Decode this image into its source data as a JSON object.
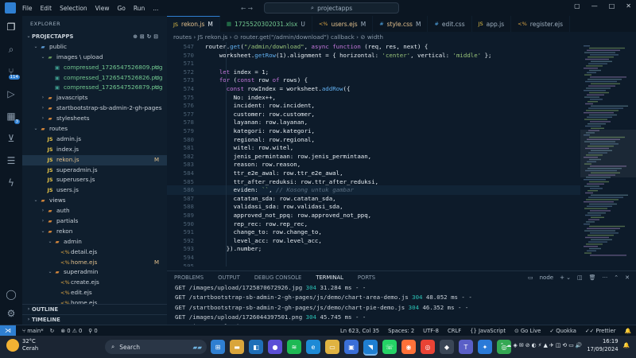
{
  "menu": {
    "items": [
      "File",
      "Edit",
      "Selection",
      "View",
      "Go",
      "Run",
      "..."
    ]
  },
  "command_center": {
    "text": "projectapps"
  },
  "activity_bar": {
    "badge_scm": "114",
    "badge_ext": "3"
  },
  "explorer": {
    "header": "EXPLORER",
    "project": "PROJECTAPPS",
    "rows": [
      {
        "label": "public",
        "indent": 1,
        "chev": "⌄",
        "icon": "dir-blue",
        "status": ""
      },
      {
        "label": "images \\ upload",
        "indent": 2,
        "chev": "⌄",
        "icon": "dir-green",
        "status": ""
      },
      {
        "label": "compressed_1726547526809.png",
        "indent": 3,
        "chev": "",
        "icon": "img",
        "status": "U"
      },
      {
        "label": "compressed_1726547526826.png",
        "indent": 3,
        "chev": "",
        "icon": "img",
        "status": "U"
      },
      {
        "label": "compressed_1726547526879.png",
        "indent": 3,
        "chev": "",
        "icon": "img",
        "status": "U"
      },
      {
        "label": "javascripts",
        "indent": 2,
        "chev": "›",
        "icon": "dir",
        "status": ""
      },
      {
        "label": "startbootstrap-sb-admin-2-gh-pages",
        "indent": 2,
        "chev": "›",
        "icon": "dir",
        "status": ""
      },
      {
        "label": "stylesheets",
        "indent": 2,
        "chev": "›",
        "icon": "dir",
        "status": ""
      },
      {
        "label": "routes",
        "indent": 1,
        "chev": "⌄",
        "icon": "dir",
        "status": ""
      },
      {
        "label": "admin.js",
        "indent": 2,
        "chev": "",
        "icon": "js",
        "status": ""
      },
      {
        "label": "index.js",
        "indent": 2,
        "chev": "",
        "icon": "js",
        "status": ""
      },
      {
        "label": "rekon.js",
        "indent": 2,
        "chev": "",
        "icon": "js",
        "status": "M",
        "selected": true
      },
      {
        "label": "superadmin.js",
        "indent": 2,
        "chev": "",
        "icon": "js",
        "status": ""
      },
      {
        "label": "superusers.js",
        "indent": 2,
        "chev": "",
        "icon": "js",
        "status": ""
      },
      {
        "label": "users.js",
        "indent": 2,
        "chev": "",
        "icon": "js",
        "status": ""
      },
      {
        "label": "views",
        "indent": 1,
        "chev": "⌄",
        "icon": "dir",
        "status": ""
      },
      {
        "label": "auth",
        "indent": 2,
        "chev": "›",
        "icon": "dir",
        "status": ""
      },
      {
        "label": "partials",
        "indent": 2,
        "chev": "›",
        "icon": "dir",
        "status": ""
      },
      {
        "label": "rekon",
        "indent": 2,
        "chev": "⌄",
        "icon": "dir",
        "status": ""
      },
      {
        "label": "admin",
        "indent": 3,
        "chev": "⌄",
        "icon": "dir",
        "status": ""
      },
      {
        "label": "detail.ejs",
        "indent": 4,
        "chev": "",
        "icon": "ejs",
        "status": ""
      },
      {
        "label": "home.ejs",
        "indent": 4,
        "chev": "",
        "icon": "ejs",
        "status": "M"
      },
      {
        "label": "superadmin",
        "indent": 3,
        "chev": "⌄",
        "icon": "dir",
        "status": ""
      },
      {
        "label": "create.ejs",
        "indent": 4,
        "chev": "",
        "icon": "ejs",
        "status": ""
      },
      {
        "label": "edit.ejs",
        "indent": 4,
        "chev": "",
        "icon": "ejs",
        "status": ""
      },
      {
        "label": "home.ejs",
        "indent": 4,
        "chev": "",
        "icon": "ejs",
        "status": ""
      }
    ],
    "outline": "OUTLINE",
    "timeline": "TIMELINE"
  },
  "tabs": [
    {
      "label": "rekon.js",
      "suffix": "M",
      "icon": "JS",
      "active": true
    },
    {
      "label": "1725520302031.xlsx",
      "suffix": "U",
      "icon": "▦",
      "active": false
    },
    {
      "label": "users.ejs",
      "suffix": "M",
      "icon": "<%",
      "active": false
    },
    {
      "label": "style.css",
      "suffix": "M",
      "icon": "#",
      "active": false
    },
    {
      "label": "edit.css",
      "suffix": "",
      "icon": "#",
      "active": false
    },
    {
      "label": "app.js",
      "suffix": "",
      "icon": "JS",
      "active": false
    },
    {
      "label": "register.ejs",
      "suffix": "",
      "icon": "<%",
      "active": false
    }
  ],
  "breadcrumb": "routes  ›  JS rekon.js  ›  ⊙ router.get(\"/admin/download\") callback  ›  ⊘ width",
  "code_lines": [
    {
      "n": "547",
      "html": "router.<f>get</f>(<s>\"/admin/download\"</s>, <k>async</k> <k>function</k> (req, res, next) {"
    },
    {
      "n": "570",
      "html": "    worksheet.<f>getRow</f>(1).alignment = { horizontal: <s>'center'</s>, vertical: <s>'middle'</s> };"
    },
    {
      "n": "571",
      "html": ""
    },
    {
      "n": "572",
      "html": "    <k>let</k> index = 1;"
    },
    {
      "n": "573",
      "html": "    <k>for</k> (<k>const</k> row <k>of</k> rows) {"
    },
    {
      "n": "574",
      "html": "      <k>const</k> rowIndex = worksheet.<f>addRow</f>({"
    },
    {
      "n": "575",
      "html": "        No: index++,"
    },
    {
      "n": "576",
      "html": "        incident: row.incident,"
    },
    {
      "n": "577",
      "html": "        customer: row.customer,"
    },
    {
      "n": "578",
      "html": "        layanan: row.layanan,"
    },
    {
      "n": "579",
      "html": "        kategori: row.kategori,"
    },
    {
      "n": "580",
      "html": "        regional: row.regional,"
    },
    {
      "n": "581",
      "html": "        witel: row.witel,"
    },
    {
      "n": "582",
      "html": "        jenis_permintaan: row.jenis_permintaan,"
    },
    {
      "n": "583",
      "html": "        reason: row.reason,"
    },
    {
      "n": "584",
      "html": "        ttr_e2e_awal: row.ttr_e2e_awal,"
    },
    {
      "n": "585",
      "html": "        ttr_after_reduksi: row.ttr_after_reduksi,"
    },
    {
      "n": "586",
      "html": "        eviden: <s>``</s>, <c>// Kosong untuk gambar</c>"
    },
    {
      "n": "587",
      "html": "        catatan_sda: row.catatan_sda,"
    },
    {
      "n": "588",
      "html": "        validasi_sda: row.validasi_sda,"
    },
    {
      "n": "589",
      "html": "        approved_not_ppq: row.approved_not_ppq,"
    },
    {
      "n": "590",
      "html": "        rep_rec: row.rep_rec,"
    },
    {
      "n": "591",
      "html": "        change_to: row.change_to,"
    },
    {
      "n": "592",
      "html": "        level_acc: row.level_acc,"
    },
    {
      "n": "593",
      "html": "      }).number;"
    },
    {
      "n": "594",
      "html": ""
    },
    {
      "n": "595",
      "html": ""
    }
  ],
  "panel": {
    "tabs": [
      "PROBLEMS",
      "OUTPUT",
      "DEBUG CONSOLE",
      "TERMINAL",
      "PORTS"
    ],
    "active": "TERMINAL",
    "shell": "node"
  },
  "terminal_lines": [
    {
      "pre": "GET /images/upload/1725870672926.jpg ",
      "code": "304",
      "post": " 31.284 ms - -"
    },
    {
      "pre": "GET /startbootstrap-sb-admin-2-gh-pages/js/demo/chart-area-demo.js ",
      "code": "304",
      "post": " 48.052 ms - -"
    },
    {
      "pre": "GET /startbootstrap-sb-admin-2-gh-pages/js/demo/chart-pie-demo.js ",
      "code": "304",
      "post": " 46.352 ms - -"
    },
    {
      "pre": "GET /images/upload/1726044397501.png ",
      "code": "304",
      "post": " 45.745 ms - -"
    },
    {
      "pre": "GET /images/upload/1726044397526.png ",
      "code": "304",
      "post": " 48.265 ms - -"
    }
  ],
  "status": {
    "branch": "main*",
    "errors": "0",
    "warnings": "0",
    "ports": "0",
    "position": "Ln 623, Col 35",
    "spaces": "Spaces: 2",
    "encoding": "UTF-8",
    "eol": "CRLF",
    "language": "{} JavaScript",
    "golive": "Go Live",
    "quokka": "Quokka",
    "prettier": "Prettier"
  },
  "taskbar": {
    "temp": "32°C",
    "weather": "Cerah",
    "search": "Search",
    "time": "16:19",
    "date": "17/09/2024",
    "apps": [
      {
        "name": "start",
        "color": "#2f7fd1",
        "glyph": "⊞"
      },
      {
        "name": "file-explorer",
        "color": "#d9a53b",
        "glyph": "▬"
      },
      {
        "name": "vscode-mini",
        "color": "#1f6fb8",
        "glyph": "◧"
      },
      {
        "name": "meet",
        "color": "#5b4fd6",
        "glyph": "●"
      },
      {
        "name": "spotify",
        "color": "#1db954",
        "glyph": "≋"
      },
      {
        "name": "edge",
        "color": "#1d8ad6",
        "glyph": "e"
      },
      {
        "name": "folder",
        "color": "#e0b341",
        "glyph": "▭"
      },
      {
        "name": "store",
        "color": "#3a6fd8",
        "glyph": "▣"
      },
      {
        "name": "vscode",
        "color": "#1f7fd1",
        "glyph": "◥"
      },
      {
        "name": "whatsapp",
        "color": "#25d366",
        "glyph": "☏"
      },
      {
        "name": "firefox",
        "color": "#ff7139",
        "glyph": "◉"
      },
      {
        "name": "chrome",
        "color": "#e94335",
        "glyph": "◎"
      },
      {
        "name": "app-dark",
        "color": "#3a4656",
        "glyph": "◆"
      },
      {
        "name": "teams",
        "color": "#5a5fc7",
        "glyph": "T"
      },
      {
        "name": "app-blue",
        "color": "#2a7ad8",
        "glyph": "✦"
      },
      {
        "name": "chrome-2",
        "color": "#34a853",
        "glyph": "◎"
      }
    ]
  }
}
